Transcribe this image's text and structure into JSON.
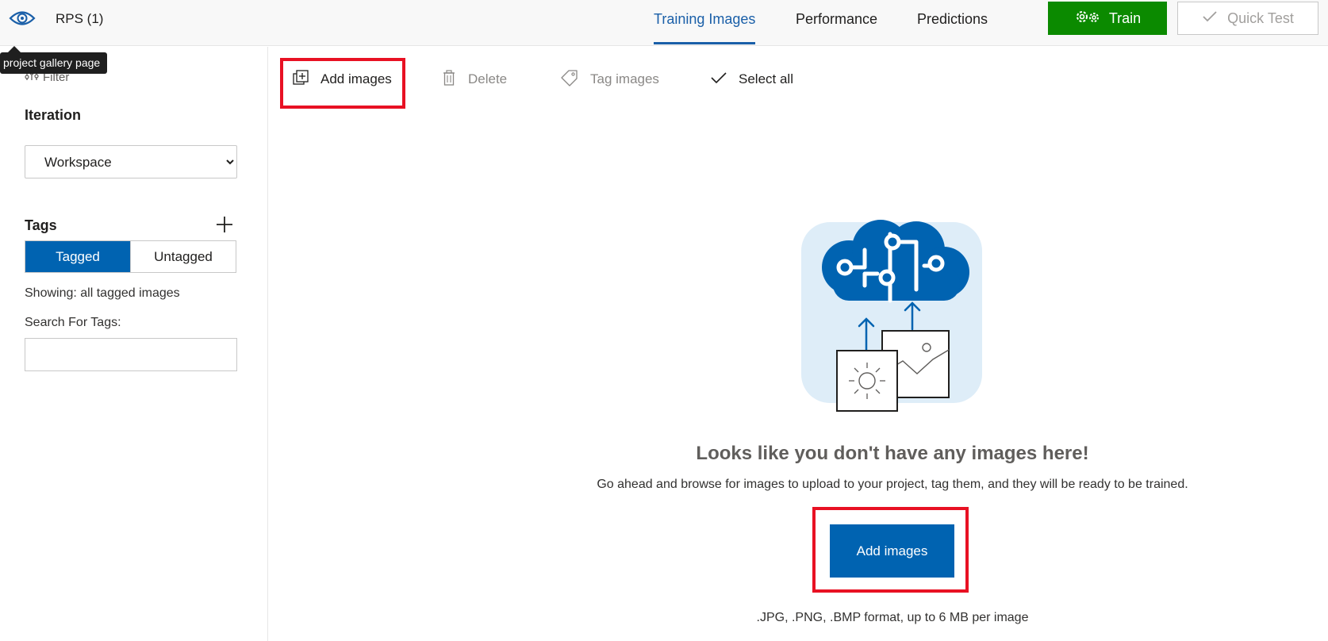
{
  "header": {
    "project_name": "RPS (1)",
    "tooltip": "project gallery page",
    "tabs": [
      {
        "label": "Training Images",
        "active": true
      },
      {
        "label": "Performance",
        "active": false
      },
      {
        "label": "Predictions",
        "active": false
      }
    ],
    "train_label": "Train",
    "quick_test_label": "Quick Test"
  },
  "sidebar": {
    "filter_label": "Filter",
    "iteration_title": "Iteration",
    "iteration_selected": "Workspace",
    "tags_title": "Tags",
    "tagged_label": "Tagged",
    "untagged_label": "Untagged",
    "showing_text": "Showing: all tagged images",
    "search_label": "Search For Tags:",
    "search_value": ""
  },
  "toolbar": {
    "add_images": "Add images",
    "delete": "Delete",
    "tag_images": "Tag images",
    "select_all": "Select all"
  },
  "empty_state": {
    "title": "Looks like you don't have any images here!",
    "description": "Go ahead and browse for images to upload to your project, tag them, and they will be ready to be trained.",
    "button_label": "Add images",
    "format_note": ".JPG, .PNG, .BMP format, up to 6 MB per image"
  },
  "colors": {
    "accent": "#0063b1",
    "train": "#0b8a00",
    "highlight": "#e81123"
  }
}
